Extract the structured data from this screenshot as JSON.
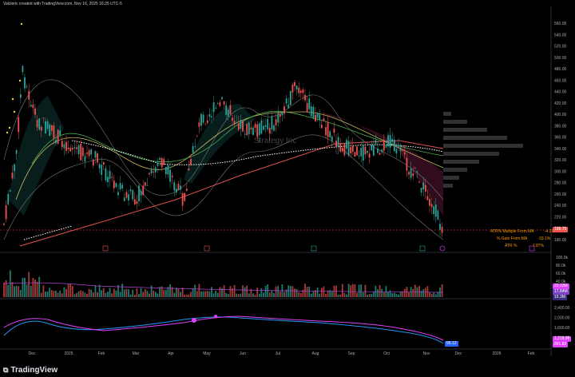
{
  "header_text": "Valcleric created with TradingView.com, Nov 16, 2025 16:25 UTC-5",
  "watermark": "Strategy Inc",
  "brand": "TradingView",
  "price_axis": [
    "560.00",
    "540.00",
    "520.00",
    "500.00",
    "480.00",
    "460.00",
    "440.00",
    "420.00",
    "400.00",
    "380.00",
    "360.00",
    "340.00",
    "320.00",
    "300.00",
    "280.00",
    "260.00",
    "240.00",
    "220.00",
    "200.00",
    "180.00"
  ],
  "current_price_label": "198.75",
  "volume_axis": [
    "100.0k",
    "80.0k",
    "60.0k",
    "40.0k",
    "20.0k"
  ],
  "volume_labels": [
    "22.23M",
    "17.84M",
    "16.3M"
  ],
  "ind_axis": [
    "2,400.00",
    "2,000.00",
    "1,600.00",
    "1,200.00"
  ],
  "ind_labels": [
    "1,218.98",
    "891.83"
  ],
  "ind_left_label": "95.12",
  "time_axis": [
    "Dec",
    "2025",
    "Feb",
    "Mar",
    "Apr",
    "May",
    "Jun",
    "Jul",
    "Aug",
    "Sep",
    "Oct",
    "Nov",
    "Dec",
    "2026",
    "Feb"
  ],
  "stats_table": [
    {
      "label": "ATR% Multiple From MA",
      "value": "-4.21"
    },
    {
      "label": "% Gain From MA",
      "value": "-33.1%"
    },
    {
      "label": "ATR %",
      "value": "7.87%"
    }
  ],
  "colors": {
    "up": "#26a69a",
    "down": "#ef5350",
    "ma_red": "#e05050",
    "ema_dotted": "#ffffff",
    "band": "#c03070"
  }
}
